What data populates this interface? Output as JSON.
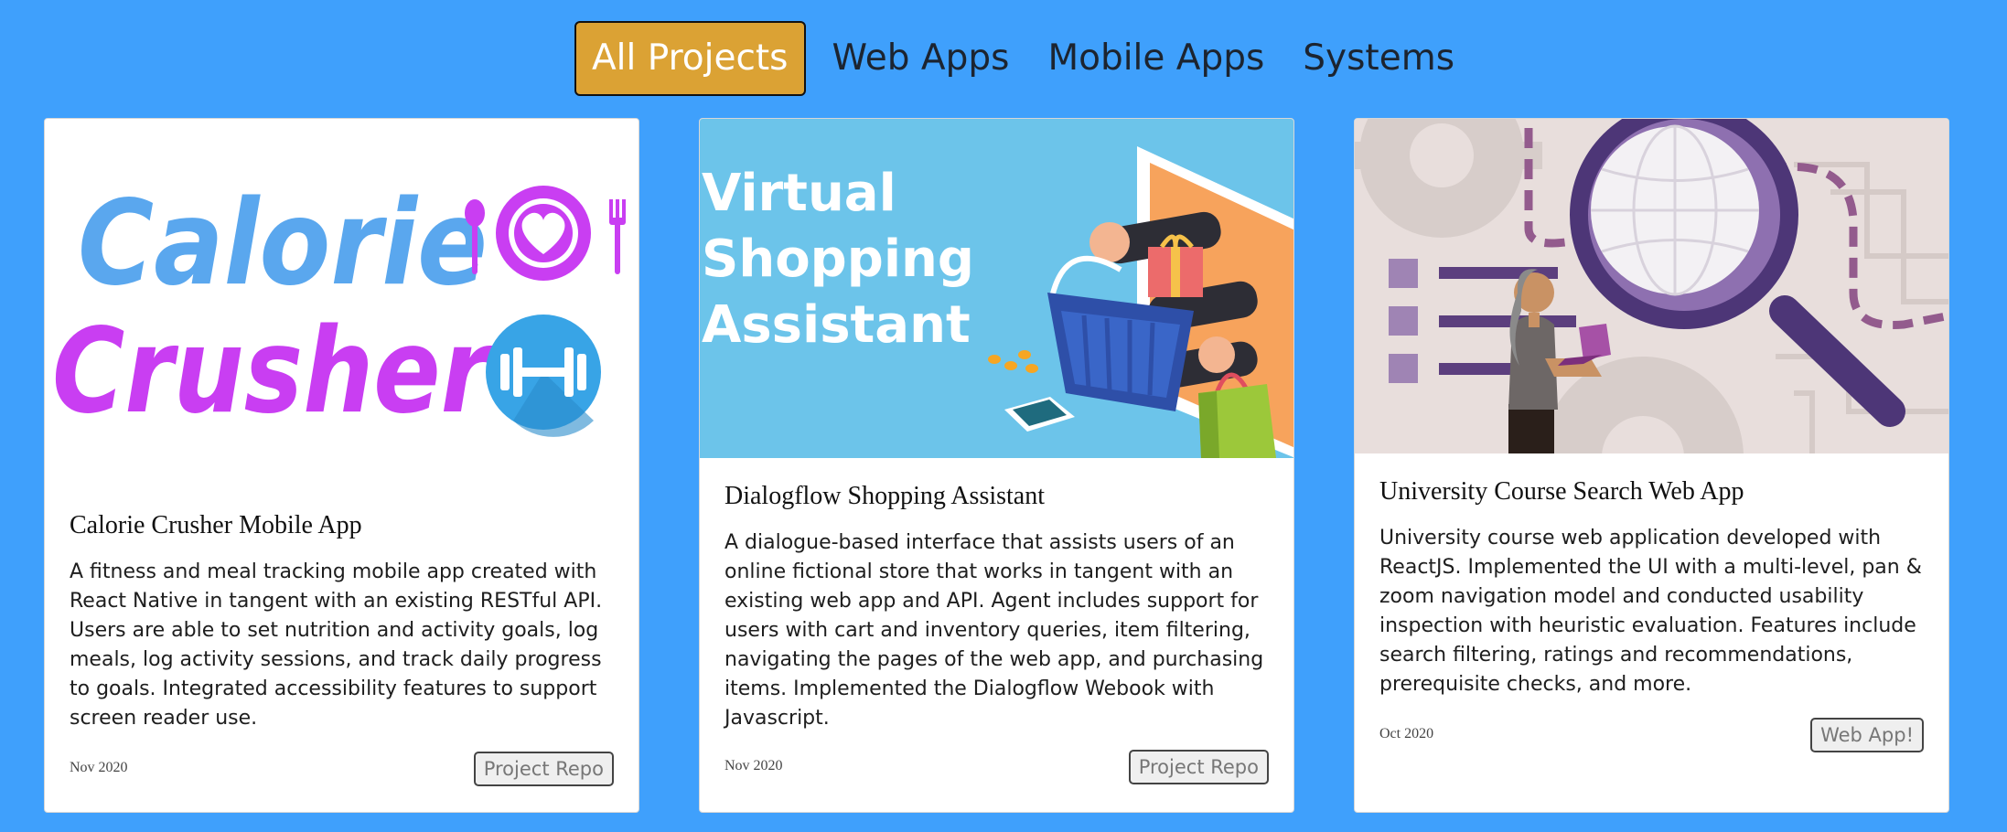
{
  "nav": {
    "tabs": [
      {
        "label": "All Projects",
        "active": true
      },
      {
        "label": "Web Apps",
        "active": false
      },
      {
        "label": "Mobile Apps",
        "active": false
      },
      {
        "label": "Systems",
        "active": false
      }
    ]
  },
  "colors": {
    "background": "#3fa0fc",
    "active_tab": "#dba234",
    "card": "#ffffff"
  },
  "projects": [
    {
      "image": {
        "line1": "Calorie",
        "line2": "Crusher",
        "icons": [
          "plate-heart-icon",
          "dumbbell-icon"
        ]
      },
      "title": "Calorie Crusher Mobile App",
      "description": "A fitness and meal tracking mobile app created with React Native in tangent with an existing RESTful API. Users are able to set nutrition and activity goals, log meals, log activity sessions, and track daily progress to goals. Integrated accessibility features to support screen reader use.",
      "date": "Nov 2020",
      "button": "Project Repo"
    },
    {
      "image": {
        "line1": "Virtual",
        "line2": "Shopping",
        "line3": "Assistant",
        "icons": [
          "shopping-basket-icon",
          "phone-icon",
          "shopping-bag-icon"
        ]
      },
      "title": "Dialogflow Shopping Assistant",
      "description": "A dialogue-based interface that assists users of an online fictional store that works in tangent with an existing web app and API. Agent includes support for users with cart and inventory queries, item filtering, navigating the pages of the web app, and purchasing items. Implemented the Dialogflow Webook with Javascript.",
      "date": "Nov 2020",
      "button": "Project Repo"
    },
    {
      "image": {
        "icons": [
          "magnifying-glass-icon",
          "gear-icon",
          "person-with-laptop-icon"
        ]
      },
      "title": "University Course Search Web App",
      "description": "University course web application developed with ReactJS. Implemented the UI with a multi-level, pan & zoom navigation model and conducted usability inspection with heuristic evaluation. Features include search filtering, ratings and recommendations, prerequisite checks, and more.",
      "date": "Oct 2020",
      "button": "Web App!"
    }
  ]
}
